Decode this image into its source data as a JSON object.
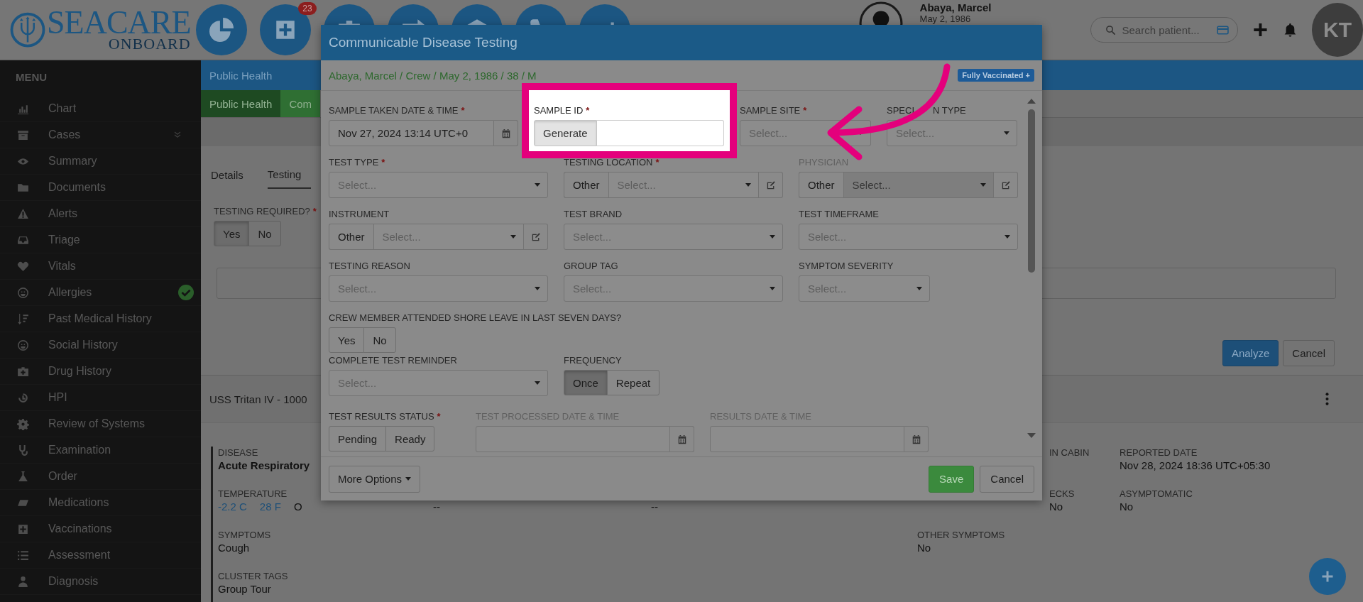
{
  "header": {
    "logo_word": "SEACARE",
    "logo_sub": "ONBOARD",
    "notification_badge": "23",
    "patient": {
      "name": "Abaya, Marcel",
      "dob": "May 2, 1986"
    },
    "search": {
      "placeholder": "Search patient..."
    },
    "user_initials": "KT"
  },
  "sidebar": {
    "title": "MENU",
    "items": [
      {
        "label": "Chart",
        "expandable": false,
        "done": false
      },
      {
        "label": "Cases",
        "expandable": true,
        "done": false
      },
      {
        "label": "Summary",
        "expandable": false,
        "done": false
      },
      {
        "label": "Documents",
        "expandable": false,
        "done": false
      },
      {
        "label": "Alerts",
        "expandable": false,
        "done": false
      },
      {
        "label": "Triage",
        "expandable": false,
        "done": false
      },
      {
        "label": "Vitals",
        "expandable": false,
        "done": false
      },
      {
        "label": "Allergies",
        "expandable": false,
        "done": true
      },
      {
        "label": "Past Medical History",
        "expandable": false,
        "done": false
      },
      {
        "label": "Social History",
        "expandable": false,
        "done": false
      },
      {
        "label": "Drug History",
        "expandable": false,
        "done": false
      },
      {
        "label": "HPI",
        "expandable": false,
        "done": false
      },
      {
        "label": "Review of Systems",
        "expandable": false,
        "done": false
      },
      {
        "label": "Examination",
        "expandable": false,
        "done": false
      },
      {
        "label": "Order",
        "expandable": false,
        "done": false
      },
      {
        "label": "Medications",
        "expandable": false,
        "done": false
      },
      {
        "label": "Vaccinations",
        "expandable": false,
        "done": false
      },
      {
        "label": "Assessment",
        "expandable": false,
        "done": false
      },
      {
        "label": "Diagnosis",
        "expandable": false,
        "done": false
      }
    ]
  },
  "main": {
    "section_title": "Public Health",
    "tabs": [
      {
        "label": "Public Health",
        "selected": true
      },
      {
        "label": "Com",
        "selected": false
      }
    ],
    "subtabs": [
      {
        "label": "Details",
        "selected": false
      },
      {
        "label": "Testing",
        "selected": true
      }
    ],
    "testing_required": {
      "label": "TESTING REQUIRED?",
      "required_mark": "*",
      "options": [
        {
          "label": "Yes",
          "selected": true
        },
        {
          "label": "No",
          "selected": false
        }
      ]
    },
    "actions": [
      {
        "label": "Analyze",
        "kind": "primary"
      },
      {
        "label": "Cancel",
        "kind": "default"
      }
    ],
    "vessel": "USS Tritan IV - 1000",
    "details": [
      {
        "column_1": {
          "label": "DISEASE",
          "value": "Acute Respiratory"
        },
        "column_4": {
          "kind": "tail",
          "label": "IN CABIN"
        },
        "column_5": {
          "label": "REPORTED DATE",
          "value": "Nov 28, 2024 18:36 UTC+05:30"
        }
      },
      {
        "column_1": {
          "label": "TEMPERATURE",
          "values": [
            {
              "text": "-2.2 C",
              "kind": "link"
            },
            {
              "text": "28 F",
              "kind": "link"
            },
            {
              "text": "O",
              "kind": "plain"
            }
          ]
        },
        "column_2": {
          "value": "--"
        },
        "column_3": {
          "value": "--"
        },
        "column_4": {
          "kind": "tail",
          "label": "ECKS",
          "value": "No"
        },
        "column_5": {
          "label": "ASYMPTOMATIC",
          "value": "No"
        }
      },
      {
        "column_1": {
          "label": "SYMPTOMS",
          "value": "Cough"
        },
        "column_4": {
          "label": "OTHER SYMPTOMS",
          "value": "No"
        }
      },
      {
        "column_1": {
          "label": "CLUSTER TAGS",
          "value": "Group Tour"
        }
      }
    ]
  },
  "dialog": {
    "title": "Communicable Disease Testing",
    "patient_line": "Abaya, Marcel / Crew / May 2, 1986 / 38 / M",
    "badge": "Fully Vaccinated +",
    "rows": [
      [
        {
          "kind": "date",
          "label": "SAMPLE TAKEN DATE & TIME",
          "required_mark": "*",
          "value": "Nov 27, 2024 13:14 UTC+0",
          "disabled": false,
          "highlighted": false
        },
        {
          "kind": "generate",
          "label": "SAMPLE ID",
          "required_mark": "*",
          "button": "Generate",
          "disabled": false,
          "highlighted": true
        },
        {
          "kind": "select",
          "label": "SAMPLE SITE",
          "required_mark": "*",
          "placeholder": "Select...",
          "disabled": false,
          "highlighted": false
        },
        {
          "kind": "select",
          "label_parts": [
            "SPECI",
            "N TYPE"
          ],
          "placeholder": "Select...",
          "disabled": false,
          "highlighted": false
        }
      ],
      [
        {
          "kind": "select",
          "label": "TEST TYPE",
          "required_mark": "*",
          "placeholder": "Select...",
          "disabled": false,
          "highlighted": false
        },
        {
          "kind": "other_select",
          "label": "TESTING LOCATION",
          "required_mark": "*",
          "other": "Other",
          "placeholder": "Select...",
          "disabled": false,
          "highlighted": false
        },
        {
          "kind": "other_select",
          "label": "PHYSICIAN",
          "other": "Other",
          "placeholder": "Select...",
          "disabled": true,
          "highlighted": false
        }
      ],
      [
        {
          "kind": "other_select",
          "label": "INSTRUMENT",
          "other": "Other",
          "placeholder": "Select...",
          "disabled": false,
          "highlighted": false
        },
        {
          "kind": "select",
          "label": "TEST BRAND",
          "placeholder": "Select...",
          "disabled": false,
          "highlighted": false
        },
        {
          "kind": "select",
          "label": "TEST TIMEFRAME",
          "placeholder": "Select...",
          "disabled": false,
          "highlighted": false
        }
      ],
      [
        {
          "kind": "select",
          "label": "TESTING REASON",
          "placeholder": "Select...",
          "disabled": false,
          "highlighted": false
        },
        {
          "kind": "select",
          "label": "GROUP TAG",
          "placeholder": "Select...",
          "disabled": false,
          "highlighted": false
        },
        {
          "kind": "select",
          "label": "SYMPTOM SEVERITY",
          "placeholder": "Select...",
          "disabled": false,
          "highlighted": false
        }
      ],
      [
        {
          "kind": "toggle",
          "label": "CREW MEMBER ATTENDED SHORE LEAVE IN LAST SEVEN DAYS?",
          "options": [
            {
              "label": "Yes",
              "selected": false
            },
            {
              "label": "No",
              "selected": false
            }
          ],
          "disabled": false,
          "highlighted": false
        }
      ],
      [
        {
          "kind": "select",
          "label": "COMPLETE TEST REMINDER",
          "placeholder": "Select...",
          "disabled": false,
          "highlighted": false
        },
        {
          "kind": "toggle",
          "label": "FREQUENCY",
          "options": [
            {
              "label": "Once",
              "selected": true
            },
            {
              "label": "Repeat",
              "selected": false
            }
          ],
          "disabled": false,
          "highlighted": false
        }
      ],
      [
        {
          "kind": "toggle",
          "label": "TEST RESULTS STATUS",
          "required_mark": "*",
          "options": [
            {
              "label": "Pending",
              "selected": false
            },
            {
              "label": "Ready",
              "selected": false
            }
          ],
          "disabled": false,
          "highlighted": false
        },
        {
          "kind": "date",
          "label": "TEST PROCESSED DATE & TIME",
          "disabled": true,
          "highlighted": false
        },
        {
          "kind": "date",
          "label": "RESULTS DATE & TIME",
          "disabled": true,
          "highlighted": false
        }
      ]
    ],
    "more_options": "More Options",
    "save": "Save",
    "cancel": "Cancel"
  }
}
